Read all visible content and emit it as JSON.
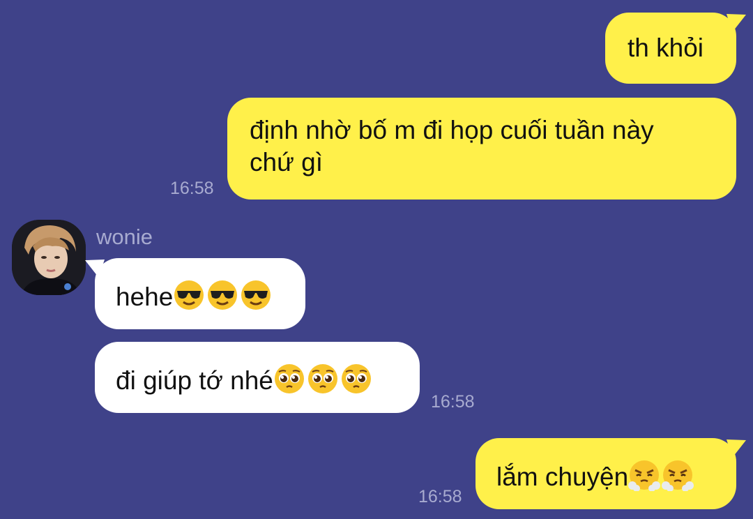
{
  "messages": [
    {
      "id": "m1",
      "sender": "me",
      "text": "th khỏi",
      "time": ""
    },
    {
      "id": "m2",
      "sender": "me",
      "text": "định nhờ bố m đi họp cuối tuần này\nchứ gì",
      "time": "16:58"
    },
    {
      "id": "m3",
      "sender": "wonie",
      "text": "hehe",
      "emojis": [
        "sunglasses-emoji",
        "sunglasses-emoji",
        "sunglasses-emoji"
      ],
      "time": ""
    },
    {
      "id": "m4",
      "sender": "wonie",
      "text": "đi giúp tớ nhé",
      "emojis": [
        "pleading-face-emoji",
        "pleading-face-emoji",
        "pleading-face-emoji"
      ],
      "time": "16:58"
    },
    {
      "id": "m5",
      "sender": "me",
      "text": "lắm chuyện",
      "emojis": [
        "steam-nose-face-emoji",
        "steam-nose-face-emoji"
      ],
      "time": "16:58"
    }
  ],
  "contact": {
    "name": "wonie",
    "avatar_icon": "profile-photo"
  },
  "colors": {
    "background": "#3f4289",
    "my_bubble": "#fff04a",
    "their_bubble": "#ffffff",
    "timestamp": "#a8abd0"
  }
}
